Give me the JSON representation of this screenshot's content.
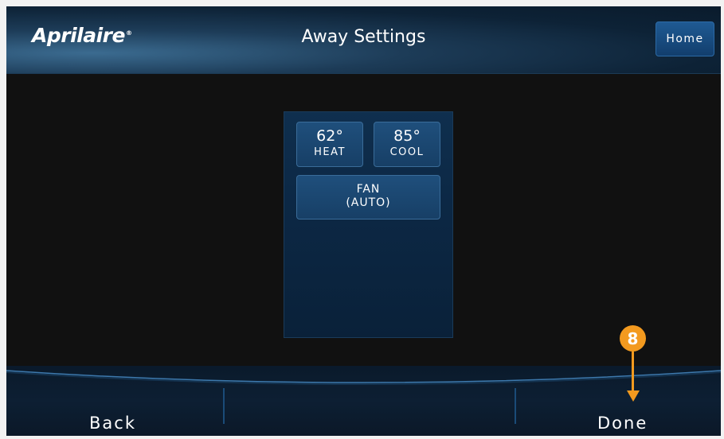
{
  "header": {
    "logo_text": "Aprilaire",
    "logo_mark": "®",
    "title": "Away Settings",
    "home_label": "Home"
  },
  "panel": {
    "heat": {
      "temp": "62°",
      "label": "HEAT"
    },
    "cool": {
      "temp": "85°",
      "label": "COOL"
    },
    "fan": {
      "line1": "FAN",
      "line2": "(AUTO)"
    }
  },
  "footer": {
    "back_label": "Back",
    "done_label": "Done"
  },
  "annotation": {
    "step": "8",
    "color": "#f39a1f"
  },
  "colors": {
    "accent_blue": "#1f5a93",
    "background": "#111111"
  }
}
